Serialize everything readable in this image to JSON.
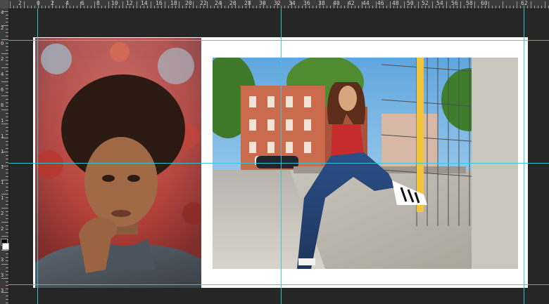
{
  "app": {
    "name": "Photoshop-like editor"
  },
  "ruler": {
    "top_labels": [
      "2",
      "0",
      "2",
      "4",
      "6",
      "8",
      "10",
      "12",
      "14",
      "16",
      "18",
      "20",
      "22",
      "24",
      "26",
      "28",
      "30",
      "32",
      "34",
      "36",
      "38",
      "40",
      "42",
      "44",
      "46",
      "48",
      "50",
      "52",
      "54",
      "56",
      "58",
      "60",
      "62"
    ],
    "left_labels": [
      "4",
      "2",
      "0",
      "2",
      "4",
      "6",
      "8",
      "1",
      "1",
      "1",
      "1",
      "1",
      "1",
      "2",
      "2",
      "2",
      "3",
      "3",
      "3"
    ]
  },
  "document": {
    "left_photo_label": "Portrait photo with red foliage background",
    "right_photo_label": "Woman sitting on concrete ledge in city street"
  },
  "colors": {
    "guide": "#35c6d8",
    "canvas_bg": "#262626",
    "ruler_bg": "#3a3a3a",
    "foreground_swatch": "#000000",
    "background_swatch": "#ffffff"
  }
}
